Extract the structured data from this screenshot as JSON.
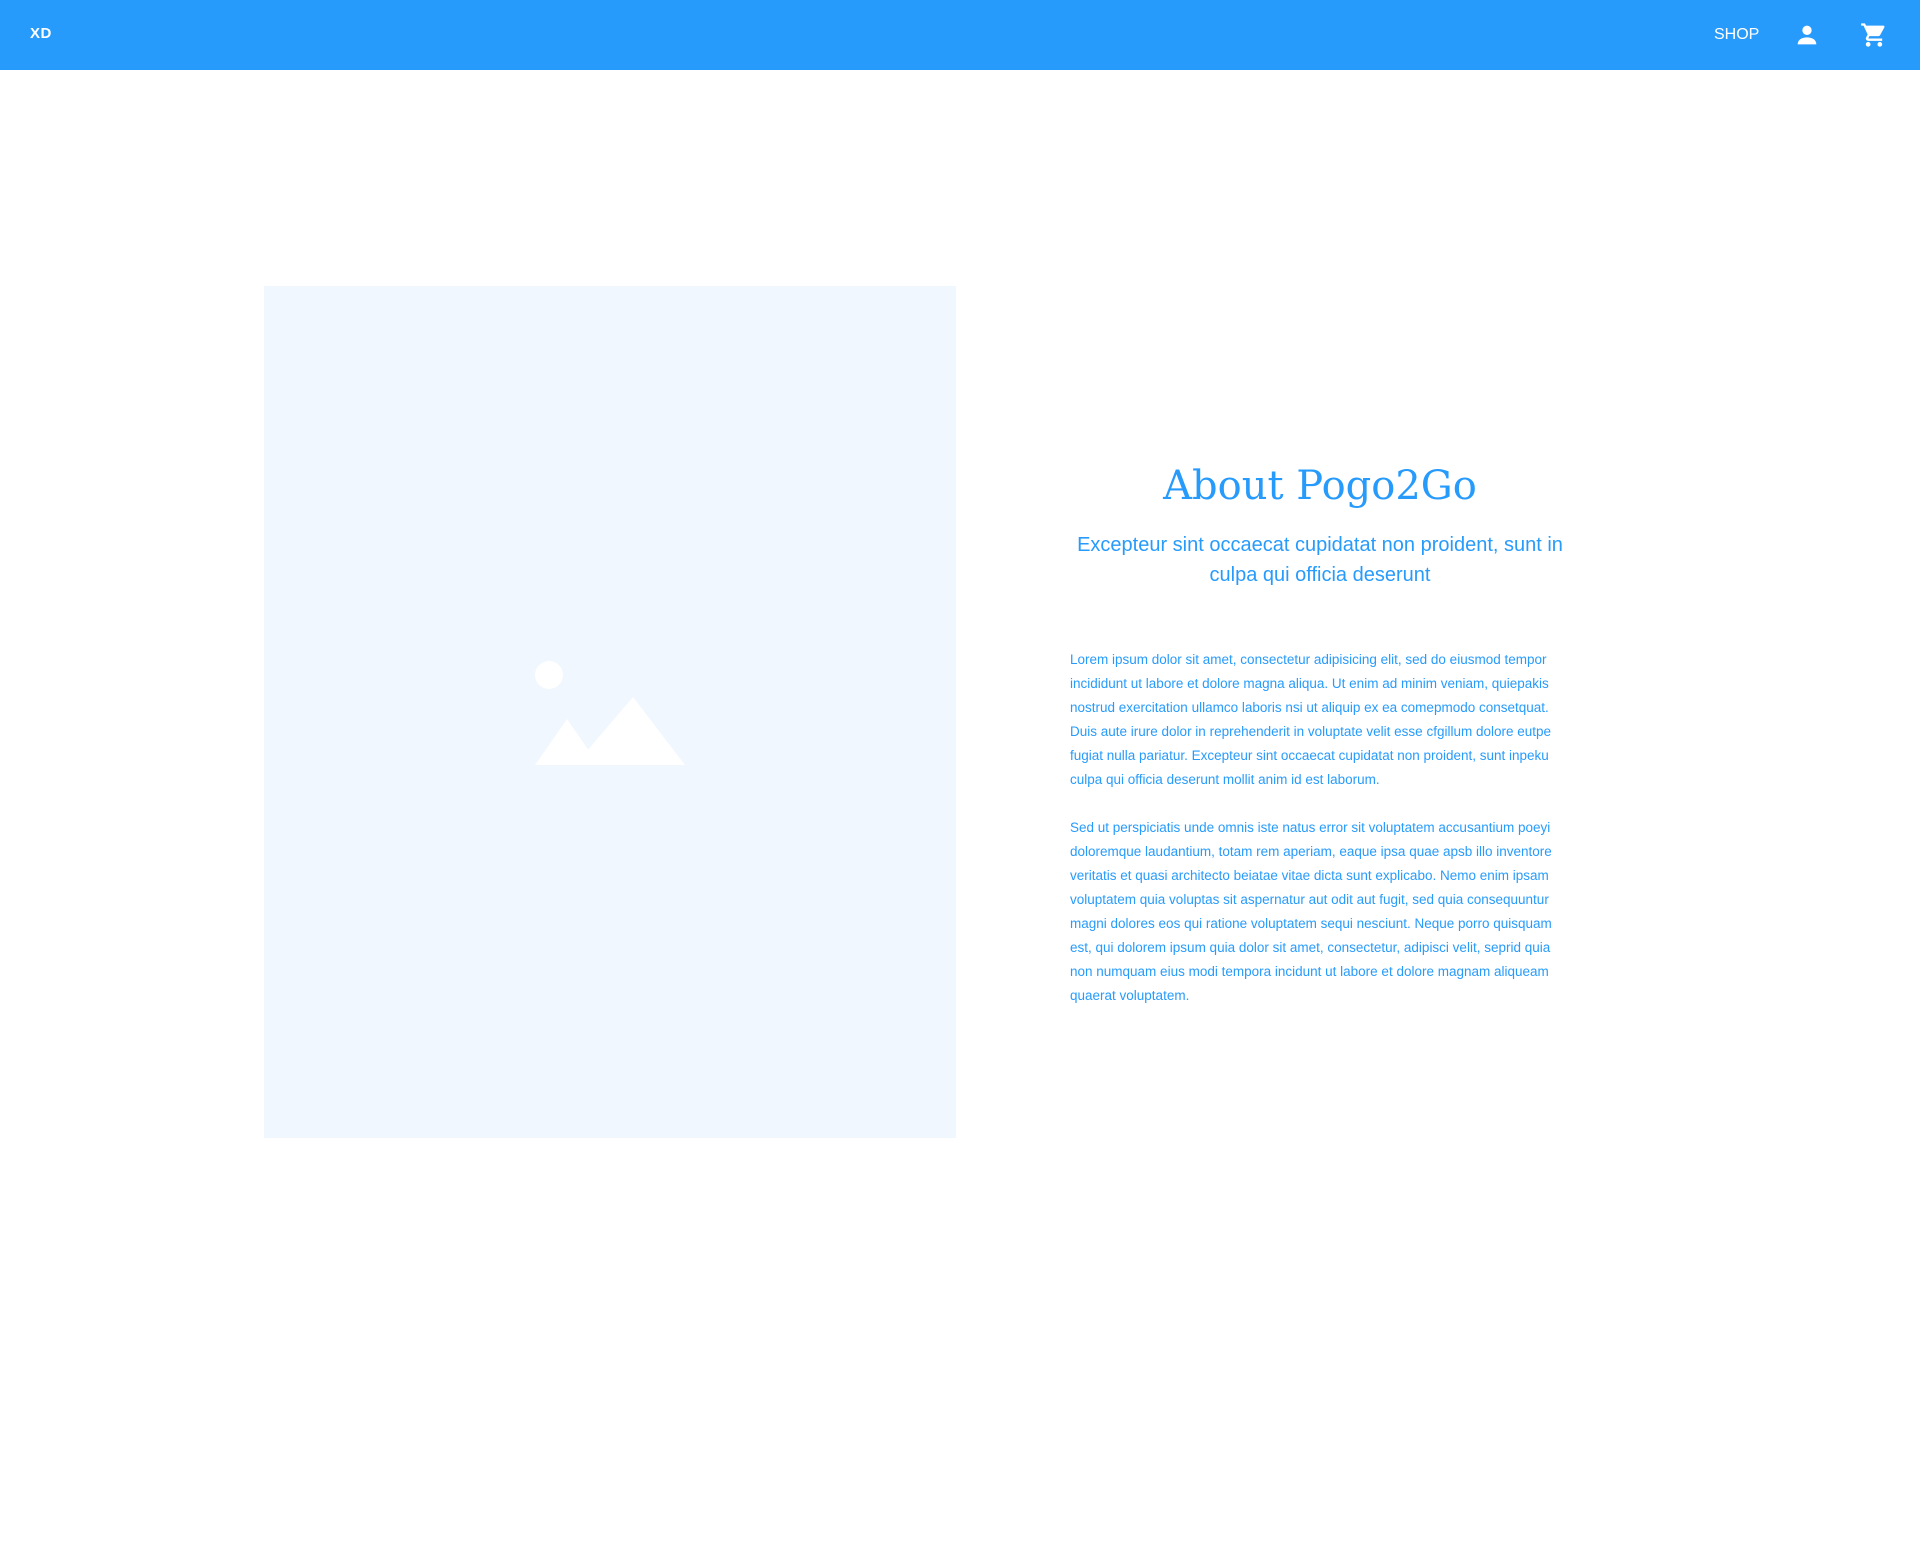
{
  "header": {
    "logo": "XD",
    "nav": {
      "shop_label": "SHOP"
    },
    "icons": {
      "user": "user-icon",
      "cart": "cart-icon"
    },
    "background_color": "#279bfc"
  },
  "hero": {
    "image_icon": "image-placeholder-icon",
    "placeholder_color": "#f0f7fe"
  },
  "about": {
    "title": "About Pogo2Go",
    "subtitle": "Excepteur sint occaecat cupidatat non proident, sunt in culpa qui officia deserunt",
    "paragraphs": [
      "Lorem ipsum dolor sit amet, consectetur adipisicing elit, sed do eiusmod tempor incididunt ut labore et dolore magna aliqua. Ut enim ad minim veniam, quiepakis nostrud exercitation ullamco laboris nsi ut aliquip ex ea comepmodo consetquat. Duis aute irure dolor in reprehenderit in voluptate velit esse cfgillum dolore eutpe fugiat nulla pariatur. Excepteur sint occaecat cupidatat non proident, sunt inpeku culpa qui officia deserunt mollit anim id est laborum.",
      "Sed ut perspiciatis unde omnis iste natus error sit voluptatem accusantium poeyi doloremque laudantium, totam rem aperiam, eaque ipsa quae apsb illo inventore veritatis et quasi architecto beiatae vitae dicta sunt explicabo. Nemo enim ipsam voluptatem quia voluptas sit aspernatur aut odit aut fugit, sed quia consequuntur magni dolores eos qui ratione voluptatem sequi nesciunt. Neque porro quisquam est, qui dolorem ipsum quia dolor sit amet, consectetur, adipisci velit, seprid quia non numquam eius modi tempora incidunt ut labore et dolore magnam aliqueam quaerat voluptatem."
    ],
    "text_color": "#279bfc"
  }
}
